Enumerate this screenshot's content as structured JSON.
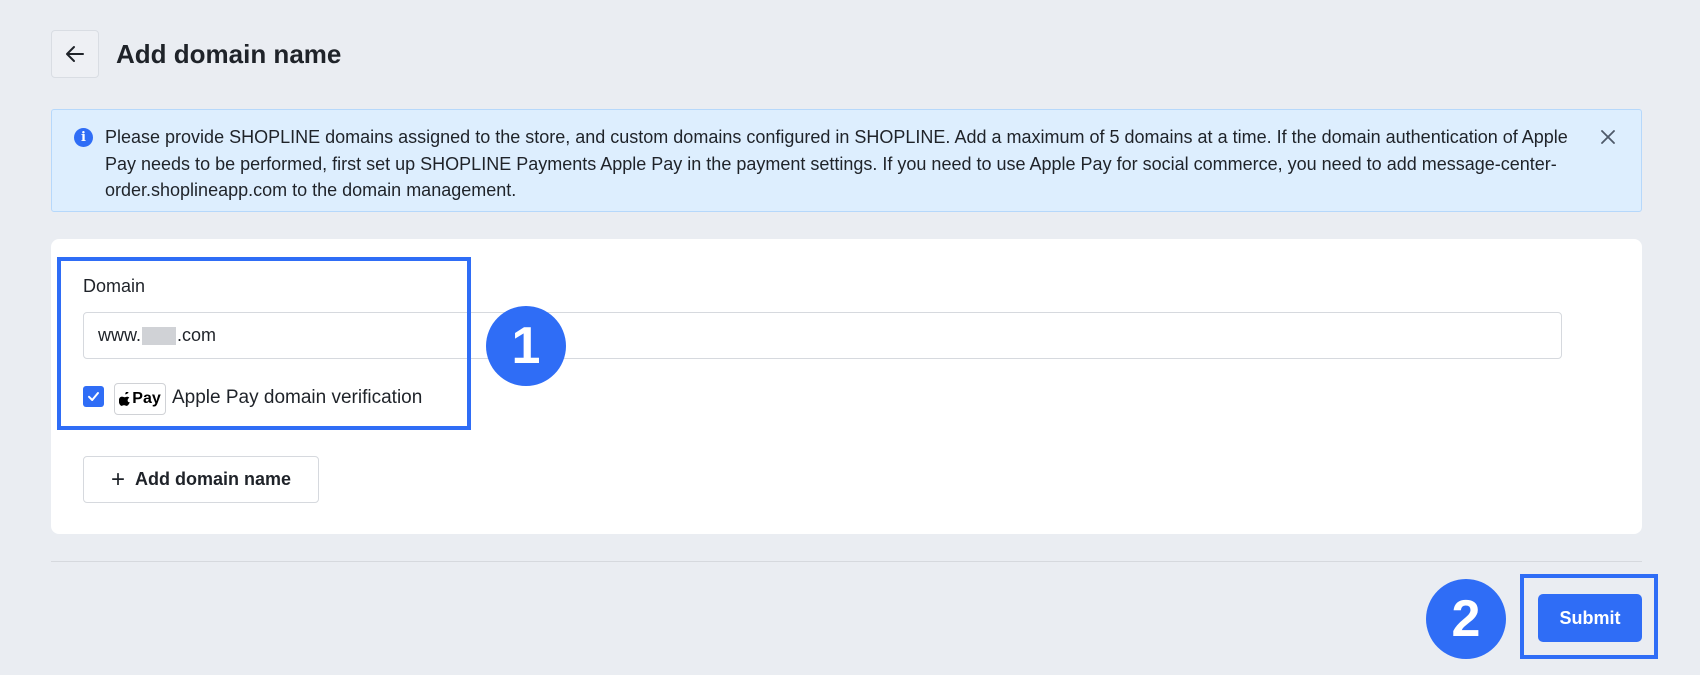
{
  "header": {
    "back_icon": "arrow-left-icon",
    "title": "Add domain name"
  },
  "alert": {
    "icon": "info-icon",
    "message": "Please provide SHOPLINE domains assigned to the store, and custom domains configured in SHOPLINE. Add a maximum of 5 domains at a time. If the domain authentication of Apple Pay needs to be performed, first set up SHOPLINE Payments Apple Pay in the payment settings. If you need to use Apple Pay for social commerce, you need to add message-center-order.shoplineapp.com to the domain management.",
    "close_icon": "close-icon"
  },
  "form": {
    "domain_label": "Domain",
    "domain_prefix": "www.",
    "domain_suffix": ".com",
    "apple_pay_checked": true,
    "apple_pay_badge": "Pay",
    "apple_pay_label": "Apple Pay domain verification",
    "add_domain_label": "Add domain name"
  },
  "annotations": {
    "marker_1": "1",
    "marker_2": "2"
  },
  "footer": {
    "submit_label": "Submit"
  },
  "colors": {
    "accent": "#2f6df6",
    "page_bg": "#eaedf2",
    "alert_bg": "#ddeefe"
  }
}
